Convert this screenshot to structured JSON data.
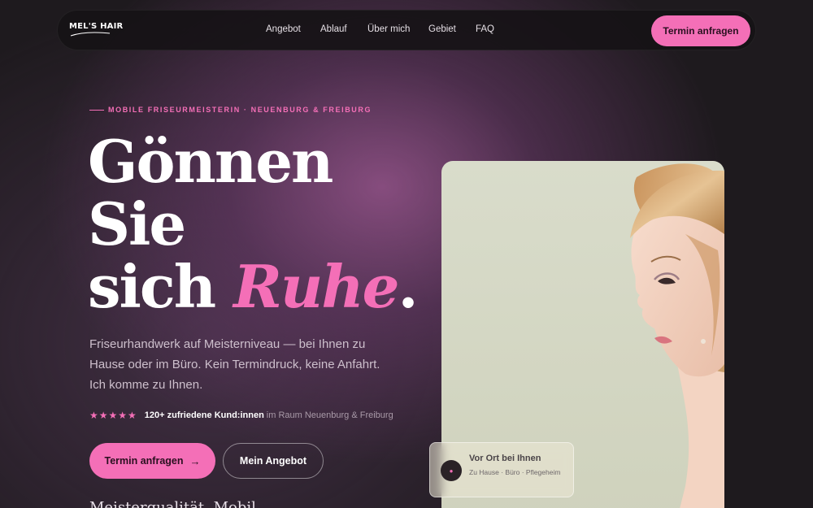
{
  "nav": {
    "logo_text": "MEL'S HAIR",
    "links": [
      "Angebot",
      "Ablauf",
      "Über mich",
      "Gebiet",
      "FAQ"
    ],
    "cta": "Termin anfragen"
  },
  "hero": {
    "eyebrow": "MOBILE FRISEURMEISTERIN · NEUENBURG & FREIBURG",
    "headline_line1": "Gönnen",
    "headline_line2": "Sie",
    "headline_line3_start": "sich ",
    "headline_accent": "Ruhe",
    "headline_end": ".",
    "subtitle": "Friseurhandwerk auf Meisterniveau — bei Ihnen zu Hause oder im Büro. Kein Termindruck, keine Anfahrt. Ich komme zu Ihnen.",
    "stars": "★★★★★",
    "rating_strong": "120+ zufriedene Kund:innen",
    "rating_muted": "im Raum Neuenburg & Freiburg",
    "primary_button": "Termin anfragen",
    "primary_arrow": "→",
    "secondary_button": "Mein Angebot",
    "next_section_peek": "Meisterqualität. Mobil."
  },
  "badge": {
    "icon": "●",
    "title": "Vor Ort bei Ihnen",
    "subtitle": "Zu Hause · Büro · Pflegeheim"
  },
  "colors": {
    "accent": "#f46fb7",
    "background": "#1e1a1e"
  }
}
